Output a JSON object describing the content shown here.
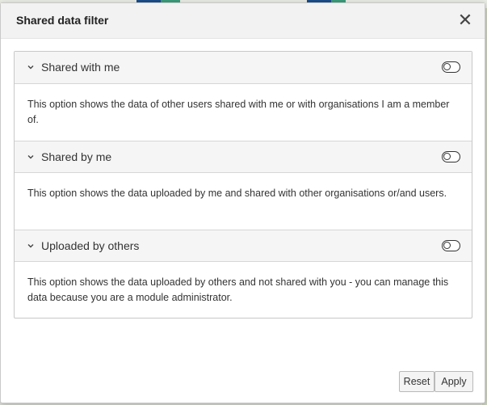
{
  "dialog": {
    "title": "Shared data filter",
    "close_symbol": "✕"
  },
  "panels": [
    {
      "label": "Shared with me",
      "description": "This option shows the data of other users shared with me or with organisations I am a member of.",
      "toggle_on": false
    },
    {
      "label": "Shared by me",
      "description": "This option shows the data uploaded by me and shared with other organisations or/and users.",
      "toggle_on": false
    },
    {
      "label": "Uploaded by others",
      "description": "This option shows the data uploaded by others and not shared with you - you can manage this data because you are a module administrator.",
      "toggle_on": false
    }
  ],
  "footer": {
    "reset_label": "Reset",
    "apply_label": "Apply"
  },
  "icons": {
    "panel_chevron": "chevron-down-icon",
    "close": "close-icon",
    "toggle": "toggle-switch-icon"
  }
}
